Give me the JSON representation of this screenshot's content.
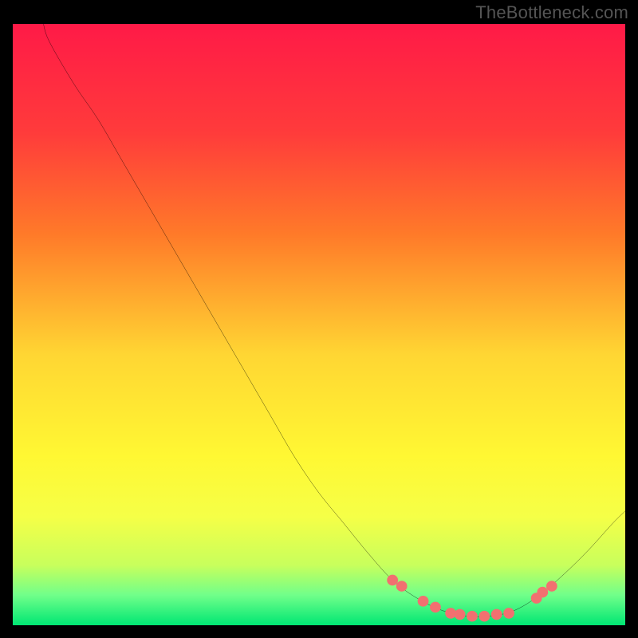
{
  "watermark": "TheBottleneck.com",
  "chart_data": {
    "type": "line",
    "title": "",
    "xlabel": "",
    "ylabel": "",
    "xlim": [
      0,
      100
    ],
    "ylim": [
      0,
      100
    ],
    "background_gradient_colors": [
      "#ff1a47",
      "#ff7a29",
      "#ffd633",
      "#fff833",
      "#d8ff47",
      "#47ff8a",
      "#00e673"
    ],
    "curve": {
      "description": "smooth valley curve",
      "points_xy": [
        [
          0.05,
          1.0
        ],
        [
          0.06,
          0.97
        ],
        [
          0.1,
          0.9
        ],
        [
          0.14,
          0.84
        ],
        [
          0.18,
          0.77
        ],
        [
          0.22,
          0.7
        ],
        [
          0.26,
          0.63
        ],
        [
          0.3,
          0.56
        ],
        [
          0.34,
          0.49
        ],
        [
          0.38,
          0.42
        ],
        [
          0.42,
          0.35
        ],
        [
          0.46,
          0.28
        ],
        [
          0.5,
          0.22
        ],
        [
          0.54,
          0.17
        ],
        [
          0.58,
          0.12
        ],
        [
          0.62,
          0.075
        ],
        [
          0.66,
          0.045
        ],
        [
          0.7,
          0.025
        ],
        [
          0.74,
          0.015
        ],
        [
          0.78,
          0.015
        ],
        [
          0.82,
          0.025
        ],
        [
          0.86,
          0.05
        ],
        [
          0.9,
          0.085
        ],
        [
          0.94,
          0.125
        ],
        [
          0.98,
          0.17
        ],
        [
          1.0,
          0.19
        ]
      ]
    },
    "markers": {
      "color": "#f27070",
      "points_xy": [
        [
          0.62,
          0.075
        ],
        [
          0.635,
          0.065
        ],
        [
          0.67,
          0.04
        ],
        [
          0.69,
          0.03
        ],
        [
          0.715,
          0.02
        ],
        [
          0.73,
          0.018
        ],
        [
          0.75,
          0.015
        ],
        [
          0.77,
          0.015
        ],
        [
          0.79,
          0.018
        ],
        [
          0.81,
          0.02
        ],
        [
          0.855,
          0.045
        ],
        [
          0.865,
          0.055
        ],
        [
          0.88,
          0.065
        ]
      ]
    }
  }
}
